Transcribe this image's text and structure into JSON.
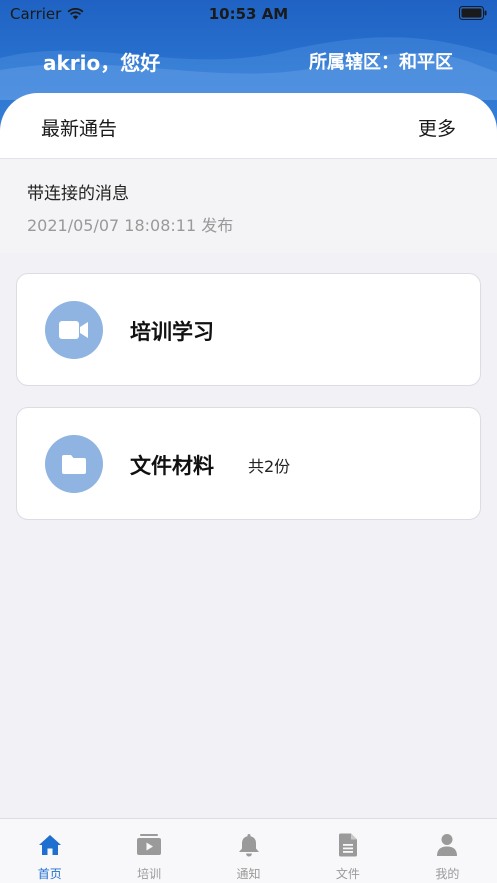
{
  "status_bar": {
    "carrier": "Carrier",
    "time": "10:53 AM"
  },
  "header": {
    "greeting": "akrio，您好",
    "district": "所属辖区：和平区"
  },
  "notice": {
    "title": "最新通告",
    "more": "更多",
    "items": [
      {
        "message": "带连接的消息",
        "date": "2021/05/07 18:08:11 发布"
      }
    ]
  },
  "cards": [
    {
      "label": "培训学习",
      "icon": "video-camera-icon",
      "count": ""
    },
    {
      "label": "文件材料",
      "icon": "folder-icon",
      "count": "共2份"
    }
  ],
  "tabbar": {
    "items": [
      {
        "label": "首页",
        "icon": "home-icon",
        "active": true
      },
      {
        "label": "培训",
        "icon": "video-play-icon",
        "active": false
      },
      {
        "label": "通知",
        "icon": "bell-icon",
        "active": false
      },
      {
        "label": "文件",
        "icon": "document-icon",
        "active": false
      },
      {
        "label": "我的",
        "icon": "person-icon",
        "active": false
      }
    ]
  },
  "colors": {
    "header_blue": "#2a73d0",
    "icon_circle": "#8fb4e2",
    "tab_active": "#1f6fd0",
    "tab_inactive": "#9a9a9a"
  }
}
